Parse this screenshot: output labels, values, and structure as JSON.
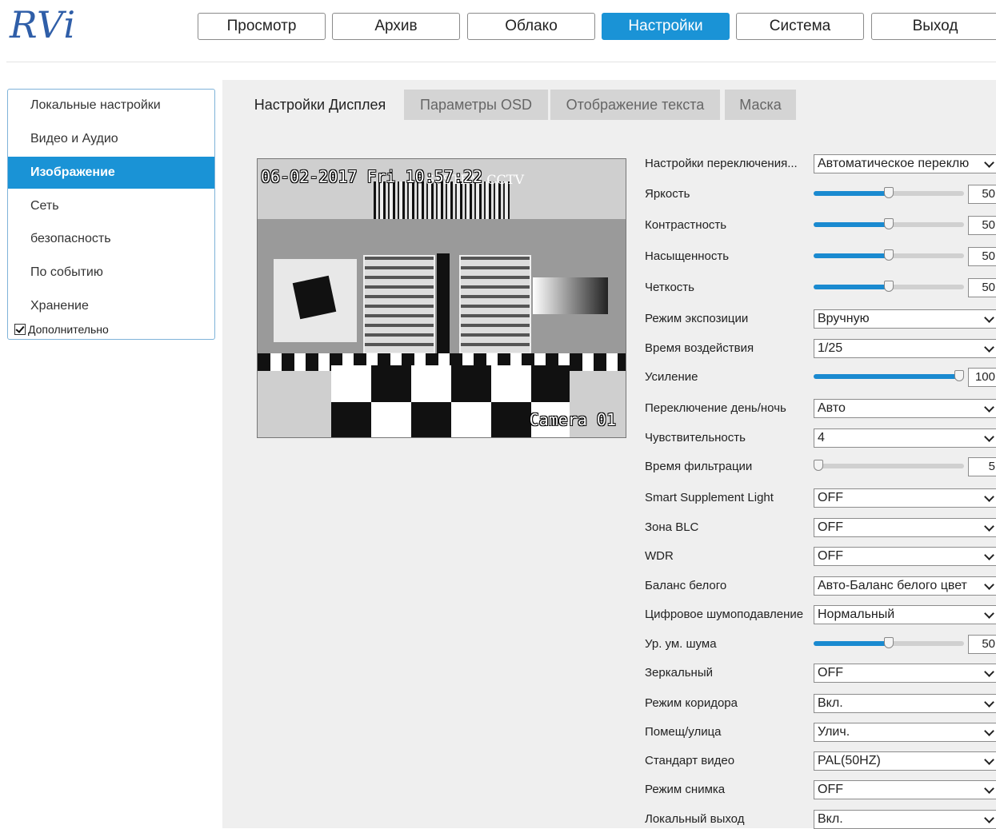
{
  "logo": "RVi",
  "nav": [
    "Просмотр",
    "Архив",
    "Облако",
    "Настройки",
    "Система",
    "Выход"
  ],
  "nav_active": 3,
  "sidebar": {
    "items": [
      "Локальные настройки",
      "Видео и Аудио",
      "Изображение",
      "Сеть",
      "безопасность",
      "По событию",
      "Хранение"
    ],
    "active": 2,
    "advanced": "Дополнительно"
  },
  "tabs": [
    "Настройки Дисплея",
    "Параметры OSD",
    "Отображение текста",
    "Маска"
  ],
  "tab_active": 0,
  "preview": {
    "timestamp": "06-02-2017 Fri 10:57:22",
    "camera_name": "Camera 01",
    "chart_text": "SYSTEM CCTV"
  },
  "settings": [
    {
      "label": "Настройки переключения...",
      "type": "select",
      "value": "Автоматическое переклю"
    },
    {
      "label": "Яркость",
      "type": "slider",
      "value": "50",
      "level": 0.5
    },
    {
      "label": "Контрастность",
      "type": "slider",
      "value": "50",
      "level": 0.5
    },
    {
      "label": "Насыщенность",
      "type": "slider",
      "value": "50",
      "level": 0.5
    },
    {
      "label": "Четкость",
      "type": "slider",
      "value": "50",
      "level": 0.5
    },
    {
      "label": "Режим экспозиции",
      "type": "select",
      "value": "Вручную"
    },
    {
      "label": "Время воздействия",
      "type": "select",
      "value": "1/25"
    },
    {
      "label": "Усиление",
      "type": "slider",
      "value": "100",
      "level": 1.0
    },
    {
      "label": "Переключение день/ночь",
      "type": "select",
      "value": "Авто"
    },
    {
      "label": "Чувствительность",
      "type": "select",
      "value": "4"
    },
    {
      "label": "Время фильтрации",
      "type": "slider",
      "value": "5",
      "level": 0.0
    },
    {
      "label": "Smart Supplement Light",
      "type": "select",
      "value": "OFF"
    },
    {
      "label": "Зона BLC",
      "type": "select",
      "value": "OFF"
    },
    {
      "label": "WDR",
      "type": "select",
      "value": "OFF"
    },
    {
      "label": "Баланс белого",
      "type": "select",
      "value": "Авто-Баланс белого цвет"
    },
    {
      "label": "Цифровое шумоподавление",
      "type": "select",
      "value": "Нормальный"
    },
    {
      "label": "Ур. ум. шума",
      "type": "slider",
      "value": "50",
      "level": 0.5
    },
    {
      "label": "Зеркальный",
      "type": "select",
      "value": "OFF"
    },
    {
      "label": "Режим коридора",
      "type": "select",
      "value": "Вкл."
    },
    {
      "label": "Помещ/улица",
      "type": "select",
      "value": "Улич."
    },
    {
      "label": "Стандарт видео",
      "type": "select",
      "value": "PAL(50HZ)"
    },
    {
      "label": "Режим снимка",
      "type": "select",
      "value": "OFF"
    },
    {
      "label": "Локальный выход",
      "type": "select",
      "value": "Вкл."
    }
  ],
  "colors": {
    "accent": "#1a93d6",
    "slider_fill": "#1a8ad0",
    "panel_bg": "#efefef"
  }
}
